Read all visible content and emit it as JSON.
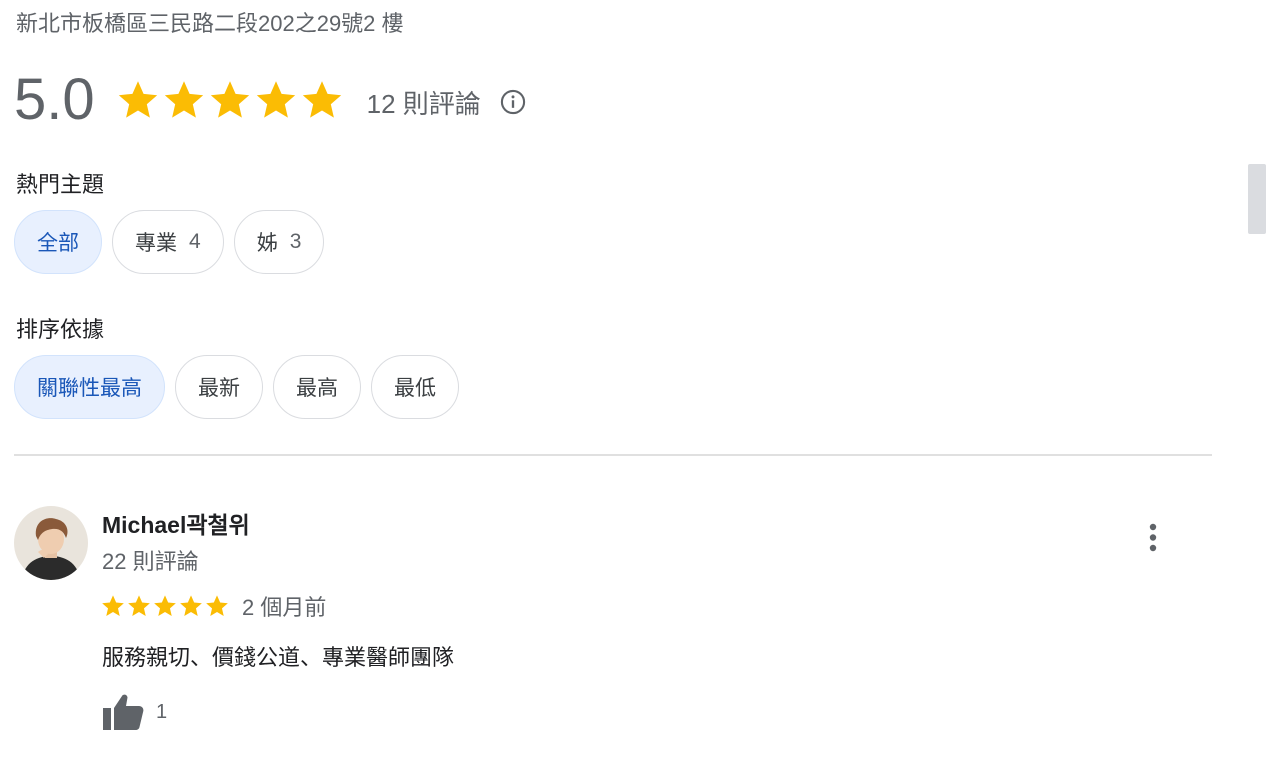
{
  "place": {
    "address": "新北市板橋區三民路二段202之29號2 樓"
  },
  "summary": {
    "rating": "5.0",
    "stars": 5,
    "review_count_label": "12 則評論",
    "star_color": "#fbbc04"
  },
  "topics": {
    "label": "熱門主題",
    "chips": [
      {
        "label": "全部",
        "count": "",
        "selected": true
      },
      {
        "label": "專業",
        "count": "4",
        "selected": false
      },
      {
        "label": "姊",
        "count": "3",
        "selected": false
      }
    ]
  },
  "sort": {
    "label": "排序依據",
    "chips": [
      {
        "label": "關聯性最高",
        "selected": true
      },
      {
        "label": "最新",
        "selected": false
      },
      {
        "label": "最高",
        "selected": false
      },
      {
        "label": "最低",
        "selected": false
      }
    ]
  },
  "review": {
    "author": "Michael곽철위",
    "author_review_count": "22 則評論",
    "stars": 5,
    "time": "2 個月前",
    "text": "服務親切、價錢公道、專業醫師團隊",
    "likes": "1"
  },
  "icons": {
    "info": "info-icon",
    "more": "more-vert-icon",
    "like": "thumb-up-icon",
    "star": "star-icon"
  }
}
